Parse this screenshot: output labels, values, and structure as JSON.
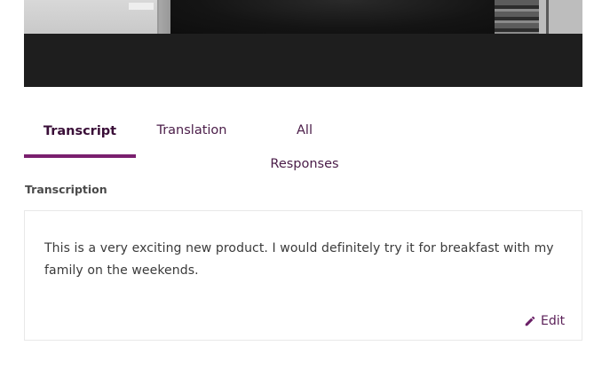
{
  "video": {
    "icon": "video-still"
  },
  "tabs": [
    {
      "label": "Transcript",
      "active": true
    },
    {
      "label": "Translation",
      "active": false
    },
    {
      "label": "All Responses",
      "active": false
    }
  ],
  "transcription": {
    "label": "Transcription",
    "text": "This is a very exciting new product. I would definitely try it for breakfast with my family on the weekends.",
    "edit_label": "Edit",
    "edit_icon": "pencil-icon"
  },
  "colors": {
    "accent": "#7a1f6e",
    "tab_text": "#4a1c48",
    "video_bg": "#1e1e1e"
  }
}
